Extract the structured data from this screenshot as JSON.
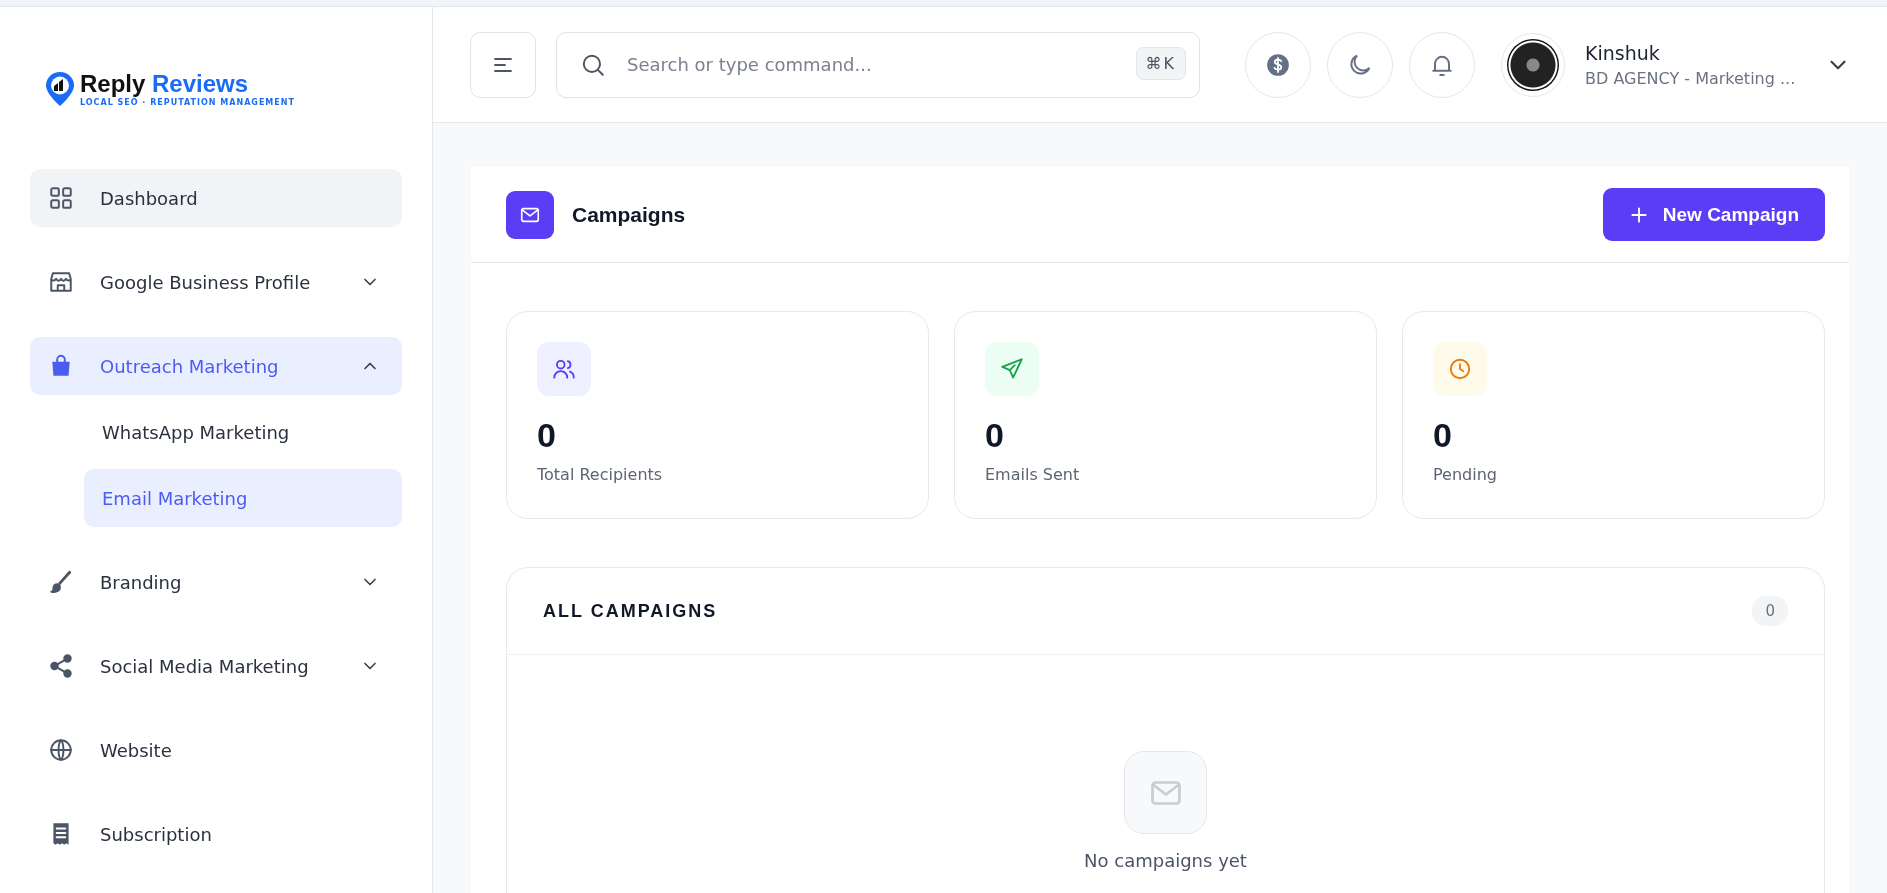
{
  "logo": {
    "brand_first": "Reply",
    "brand_second": "Reviews",
    "tagline": "LOCAL SEO · REPUTATION MANAGEMENT"
  },
  "sidebar": {
    "items": [
      {
        "label": "Dashboard",
        "selected": false,
        "hover": true
      },
      {
        "label": "Google Business Profile",
        "selected": false,
        "expanded": false
      },
      {
        "label": "Outreach Marketing",
        "selected": true,
        "expanded": true,
        "children": [
          {
            "label": "WhatsApp Marketing",
            "selected": false
          },
          {
            "label": "Email Marketing",
            "selected": true
          }
        ]
      },
      {
        "label": "Branding",
        "selected": false,
        "expanded": false
      },
      {
        "label": "Social Media Marketing",
        "selected": false,
        "expanded": false
      },
      {
        "label": "Website",
        "selected": false
      },
      {
        "label": "Subscription",
        "selected": false
      }
    ]
  },
  "header": {
    "search": {
      "placeholder": "Search or type command...",
      "shortcut": "⌘K"
    },
    "user": {
      "name": "Kinshuk",
      "organization": "BD AGENCY - Marketing ..."
    }
  },
  "page": {
    "title": "Campaigns",
    "new_button": "New Campaign",
    "stats": [
      {
        "value": "0",
        "label": "Total Recipients"
      },
      {
        "value": "0",
        "label": "Emails Sent"
      },
      {
        "value": "0",
        "label": "Pending"
      }
    ],
    "list": {
      "title": "ALL CAMPAIGNS",
      "count": "0",
      "empty_message": "No campaigns yet"
    }
  }
}
